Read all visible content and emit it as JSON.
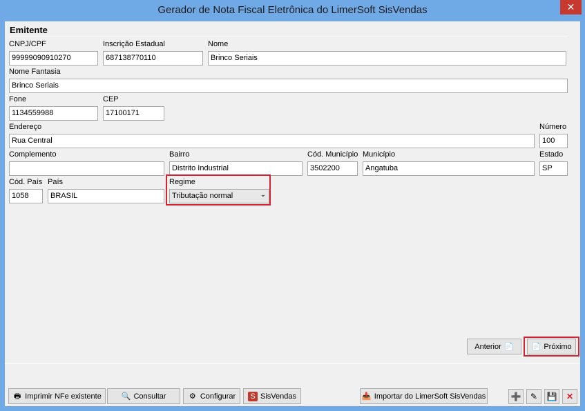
{
  "window": {
    "title": "Gerador de Nota Fiscal Eletrônica do LimerSoft SisVendas",
    "close_symbol": "✕"
  },
  "section": {
    "title": "Emitente"
  },
  "fields": {
    "cnpj": {
      "label": "CNPJ/CPF",
      "value": "99999090910270"
    },
    "ie": {
      "label": "Inscrição Estadual",
      "value": "687138770110"
    },
    "nome": {
      "label": "Nome",
      "value": "Brinco Seriais"
    },
    "fantasia": {
      "label": "Nome Fantasia",
      "value": "Brinco Seriais"
    },
    "fone": {
      "label": "Fone",
      "value": "1134559988"
    },
    "cep": {
      "label": "CEP",
      "value": "17100171"
    },
    "endereco": {
      "label": "Endereço",
      "value": "Rua Central"
    },
    "numero": {
      "label": "Número",
      "value": "100"
    },
    "complemento": {
      "label": "Complemento",
      "value": ""
    },
    "bairro": {
      "label": "Bairro",
      "value": "Distrito Industrial"
    },
    "cod_municipio": {
      "label": "Cód. Município",
      "value": "3502200"
    },
    "municipio": {
      "label": "Município",
      "value": "Angatuba"
    },
    "estado": {
      "label": "Estado",
      "value": "SP"
    },
    "cod_pais": {
      "label": "Cód. País",
      "value": "1058"
    },
    "pais": {
      "label": "País",
      "value": "BRASIL"
    },
    "regime": {
      "label": "Regime",
      "value": "Tributação normal"
    }
  },
  "nav": {
    "anterior": "Anterior",
    "proximo": "Próximo"
  },
  "footer": {
    "imprimir": "Imprimir NFe existente",
    "consultar": "Consultar",
    "configurar": "Configurar",
    "sisvendas": "SisVendas",
    "importar": "Importar do LimerSoft SisVendas"
  },
  "colors": {
    "highlight": "#d6212e",
    "titlebar": "#6fa9e6",
    "close": "#c7392e"
  }
}
